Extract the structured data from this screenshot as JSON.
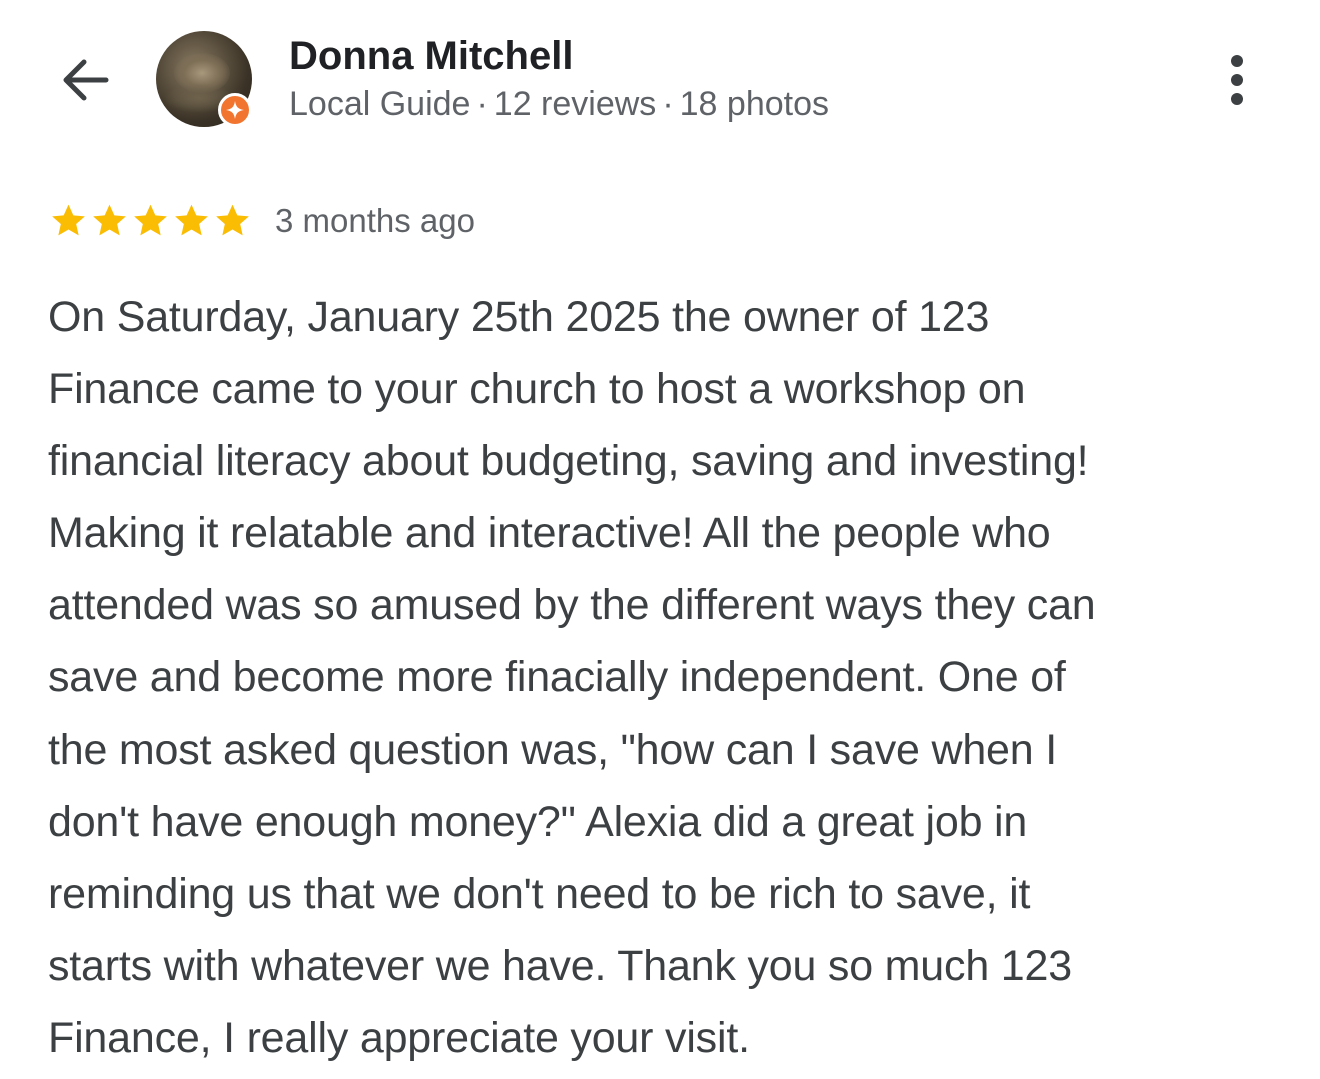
{
  "header": {
    "back_icon": "arrow-back-icon",
    "reviewer_name": "Donna Mitchell",
    "reviewer_level": "Local Guide",
    "reviews_count": "12 reviews",
    "photos_count": "18 photos",
    "separator": "·",
    "avatar_badge_icon": "local-guide-badge-icon",
    "badge_color": "#f2752f",
    "more_icon": "more-vert-icon"
  },
  "review": {
    "rating": 5,
    "rating_max": 5,
    "star_color": "#fbbc04",
    "time_ago": "3 months ago",
    "text_lines": [
      "On Saturday, January 25th 2025 the owner of 123",
      "Finance came to your church to host a workshop on",
      "financial literacy about budgeting, saving and investing!",
      "Making it relatable and interactive! All the people who",
      "attended was so amused by the different ways they can",
      "save and become more finacially independent. One of",
      "the most asked question was, \"how can I save when I",
      "don't have enough money?\" Alexia did a great job in",
      "reminding us that we don't need to be rich to save, it",
      "starts with whatever we have. Thank you so much 123",
      "Finance, I really appreciate your visit."
    ]
  }
}
